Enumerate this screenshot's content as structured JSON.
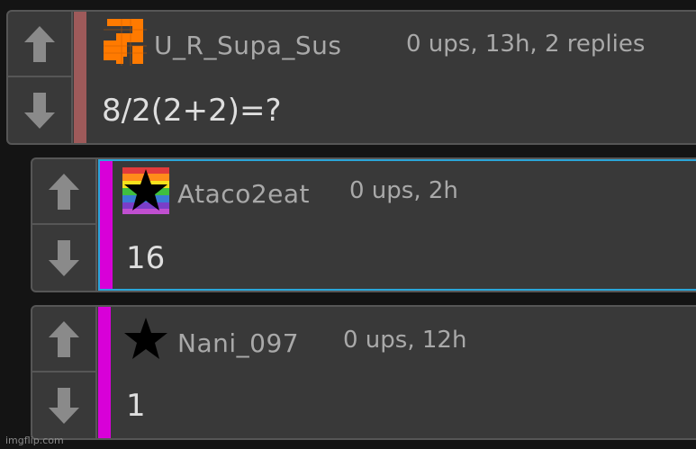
{
  "comments": [
    {
      "username": "U_R_Supa_Sus",
      "meta": "0 ups, 13h, 2 replies",
      "text": "8/2(2+2)=?",
      "stripe_color": "#9e5a5a",
      "avatar": "orange-pixel-logo-icon"
    },
    {
      "username": "Ataco2eat",
      "meta": "0 ups, 2h",
      "text": "16",
      "stripe_color": "#d800d8",
      "avatar": "rainbow-star-icon"
    },
    {
      "username": "Nani_097",
      "meta": "0 ups, 12h",
      "text": "1",
      "stripe_color": "#d800d8",
      "avatar": "star-icon"
    }
  ],
  "vote_icons": {
    "up": "arrow-up-icon",
    "down": "arrow-down-icon"
  },
  "watermark": "imgflip.com"
}
